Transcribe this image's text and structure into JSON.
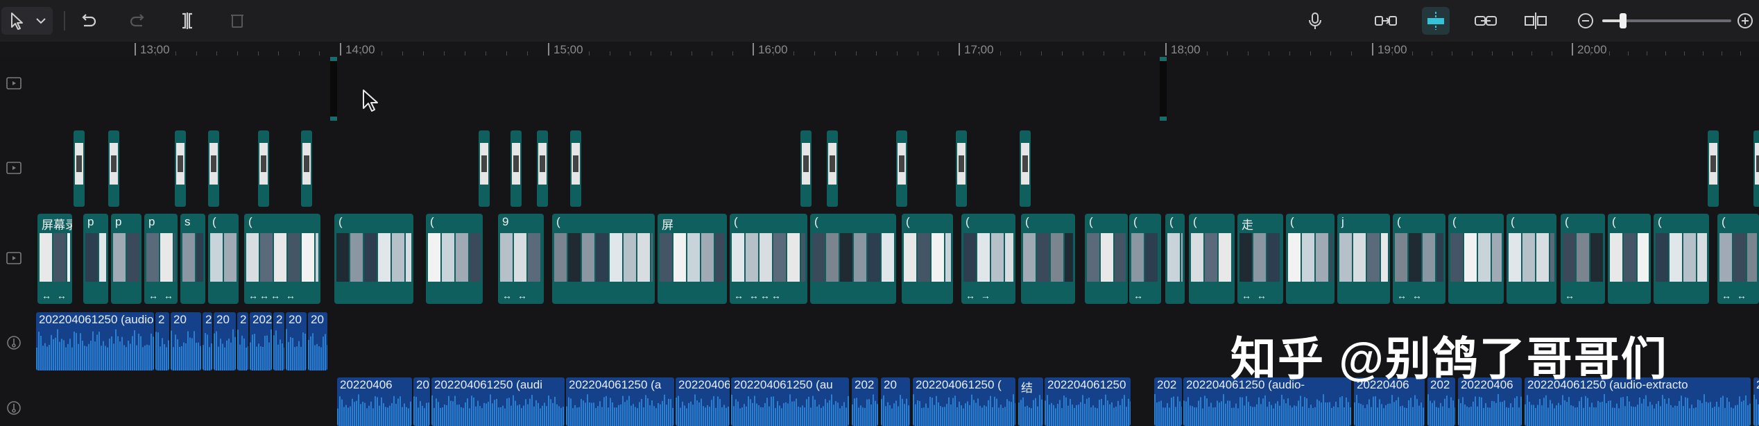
{
  "toolbar": {
    "tools_left": [
      {
        "name": "select-tool-button",
        "icon": "pointer-icon"
      },
      {
        "name": "undo-button",
        "icon": "undo-icon"
      },
      {
        "name": "redo-button",
        "icon": "redo-icon"
      },
      {
        "name": "split-button",
        "icon": "split-icon"
      },
      {
        "name": "delete-button",
        "icon": "trash-icon"
      }
    ],
    "tools_right": [
      {
        "name": "record-voice-button",
        "icon": "microphone-icon"
      },
      {
        "name": "main-track-magnet-button",
        "icon": "magnet-icon"
      },
      {
        "name": "auto-snap-button",
        "icon": "snap-icon"
      },
      {
        "name": "link-button",
        "icon": "link-icon"
      },
      {
        "name": "preview-axis-button",
        "icon": "axis-icon"
      },
      {
        "name": "zoom-out-button",
        "icon": "zoom-out-icon"
      },
      {
        "name": "zoom-in-button",
        "icon": "zoom-in-icon"
      }
    ],
    "zoom_level": 0.16,
    "accent": "#37c1d6"
  },
  "ruler": {
    "labels": [
      "13:00",
      "14:00",
      "15:00",
      "16:00",
      "17:00",
      "18:00",
      "19:00",
      "20:00"
    ]
  },
  "tracks": {
    "icons": [
      "video-track-icon",
      "video-track-icon",
      "video-track-icon",
      "audio-track-icon",
      "audio-track-icon"
    ],
    "main_clip_labels": [
      "屏幕录",
      "p",
      "p",
      "p",
      "s",
      "(",
      "(",
      "(",
      "(",
      "9",
      "(",
      "屏",
      "(",
      "(",
      "(",
      "(",
      "(",
      "(",
      "(",
      "(",
      "(",
      "走",
      "(",
      "j",
      "(",
      "(",
      "(",
      "(",
      "(",
      "(",
      "(",
      "(",
      "(",
      "(",
      "(",
      "(",
      "(",
      "(",
      "(",
      "(",
      "("
    ],
    "main_clip_arrows": [
      "↔ ↔",
      "↔ ↔ ←",
      "↔↔↔ ↔",
      "↔ ↔",
      "↔ ↔↔↔",
      "↔ →",
      "↔",
      "↔ ↔",
      "↔ ↔",
      "↔",
      "↔ ↔",
      "↔"
    ],
    "audio_row1_labels": [
      "202204061250 (audio-",
      "2",
      "20",
      "2",
      "20",
      "2",
      "202",
      "2",
      "20",
      "20"
    ],
    "audio_row2_labels": [
      "20220406",
      "20",
      "202204061250 (audi",
      "202204061250 (a",
      "20220406",
      "202204061250 (au",
      "202",
      "20",
      "202204061250 (",
      "结",
      "202204061250",
      "202",
      "202204061250 (audio-",
      "20220406",
      "202",
      "20220406",
      "202204061250 (audio-extracto",
      "2"
    ]
  },
  "watermark": {
    "text": "知乎 @别鸽了哥哥们"
  },
  "colors": {
    "clip_teal": "#0f5f5f",
    "audio_blue": "#15408a",
    "wave_blue": "#2a7fd0"
  }
}
